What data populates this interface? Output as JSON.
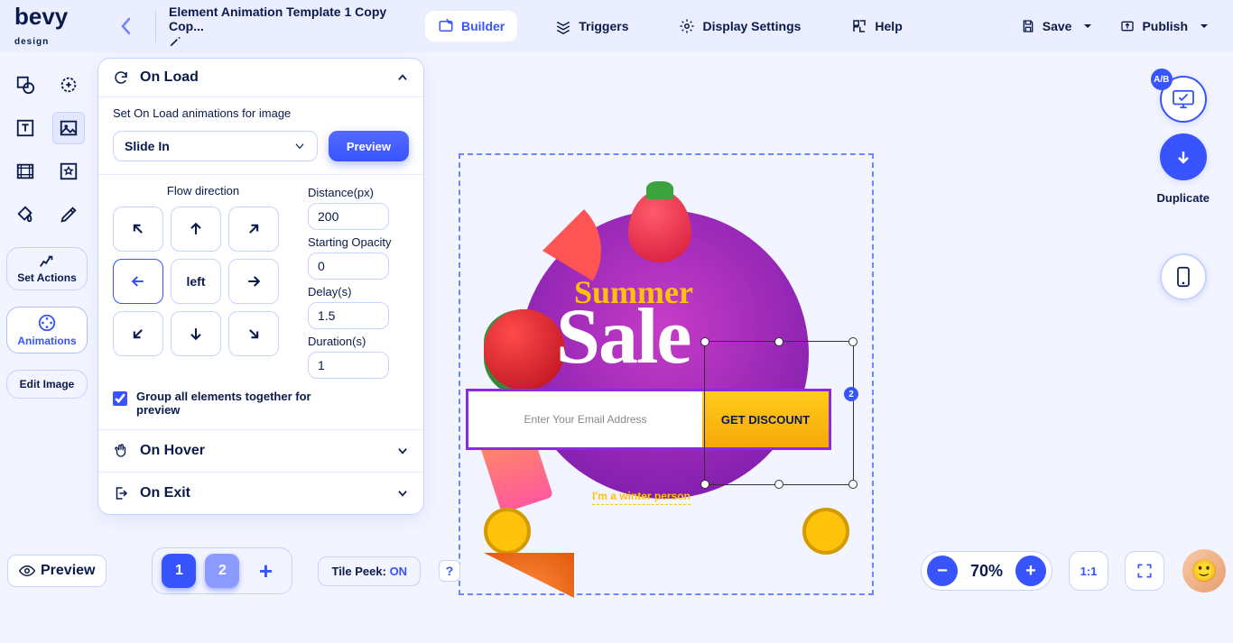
{
  "brand": {
    "name": "bevy",
    "sub": "design"
  },
  "template": {
    "title": "Element Animation Template 1 Copy Cop..."
  },
  "nav": {
    "builder": "Builder",
    "triggers": "Triggers",
    "display": "Display Settings",
    "help": "Help",
    "save": "Save",
    "publish": "Publish"
  },
  "sidebar": {
    "set_actions": "Set Actions",
    "animations": "Animations",
    "edit_image": "Edit Image"
  },
  "panel": {
    "onload": "On Load",
    "desc": "Set On Load animations for image",
    "anim_type": "Slide In",
    "preview": "Preview",
    "flow_label": "Flow direction",
    "selected_dir": "left",
    "distance_label": "Distance(px)",
    "distance": "200",
    "opacity_label": "Starting Opacity",
    "opacity": "0",
    "delay_label": "Delay(s)",
    "delay": "1.5",
    "duration_label": "Duration(s)",
    "duration": "1",
    "group_label": "Group all elements together for preview",
    "onhover": "On Hover",
    "onexit": "On Exit"
  },
  "canvas": {
    "summer": "Summer",
    "sale": "Sale",
    "email_ph": "Enter Your Email Address",
    "discount": "GET DISCOUNT",
    "winter": "I'm a winter person",
    "badge": "2"
  },
  "right": {
    "ab": "A/B",
    "duplicate": "Duplicate"
  },
  "bottom": {
    "preview": "Preview",
    "p1": "1",
    "p2": "2",
    "tile_pre": "Tile Peek: ",
    "tile_state": "ON",
    "help": "?",
    "zoom": "70%",
    "ratio": "1:1"
  }
}
